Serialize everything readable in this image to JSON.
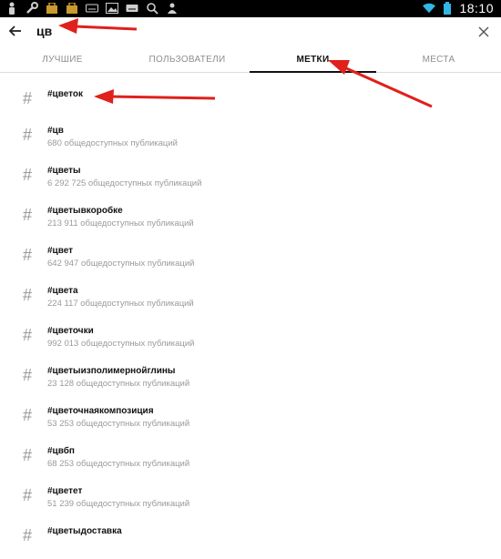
{
  "status_bar": {
    "time": "18:10",
    "icons": [
      "person-icon",
      "wrench-icon",
      "bag-icon",
      "bag-icon",
      "keyboard-icon",
      "image-icon",
      "keyboard-icon",
      "search-icon",
      "person-icon",
      "wifi-icon",
      "battery-icon"
    ]
  },
  "search": {
    "value": "цв"
  },
  "tabs": [
    "ЛУЧШИЕ",
    "ПОЛЬЗОВАТЕЛИ",
    "МЕТКИ",
    "МЕСТА"
  ],
  "active_tab": "МЕТКИ",
  "results": [
    {
      "tag": "#цветок",
      "count": ""
    },
    {
      "tag": "#цв",
      "count": "680 общедоступных публикаций"
    },
    {
      "tag": "#цветы",
      "count": "6 292 725 общедоступных публикаций"
    },
    {
      "tag": "#цветывкоробке",
      "count": "213 911 общедоступных публикаций"
    },
    {
      "tag": "#цвет",
      "count": "642 947 общедоступных публикаций"
    },
    {
      "tag": "#цвета",
      "count": "224 117 общедоступных публикаций"
    },
    {
      "tag": "#цветочки",
      "count": "992 013 общедоступных публикаций"
    },
    {
      "tag": "#цветыизполимернойглины",
      "count": "23 128 общедоступных публикаций"
    },
    {
      "tag": "#цветочнаякомпозиция",
      "count": "53 253 общедоступных публикаций"
    },
    {
      "tag": "#цвбп",
      "count": "68 253 общедоступных публикаций"
    },
    {
      "tag": "#цветет",
      "count": "51 239 общедоступных публикаций"
    },
    {
      "tag": "#цветыдоставка",
      "count": ""
    }
  ],
  "hash_symbol": "#",
  "colors": {
    "arrow": "#e0201b",
    "accent": "#111111",
    "muted": "#9a9a9a"
  }
}
